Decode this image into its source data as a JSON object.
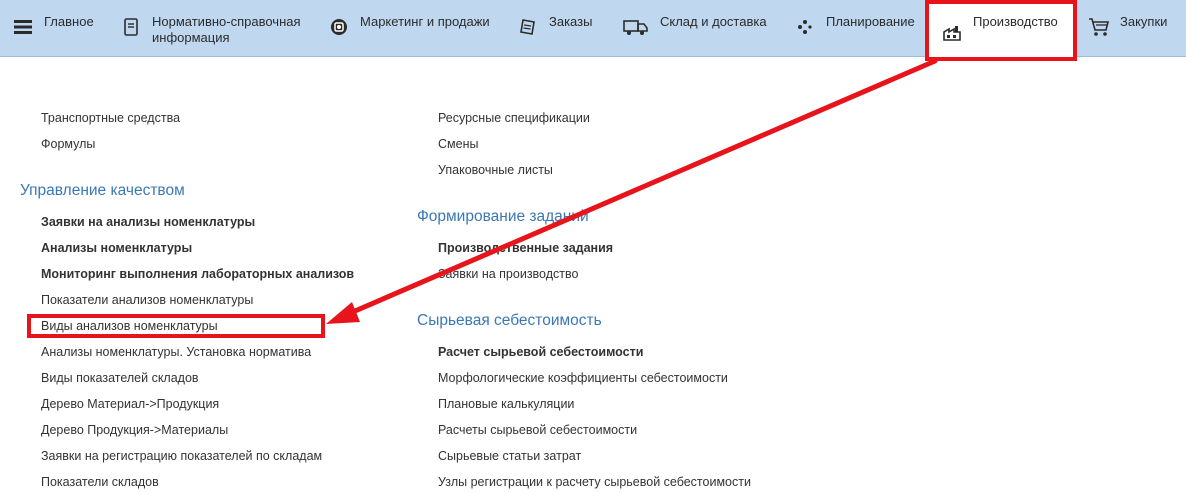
{
  "nav": {
    "items": [
      {
        "label": "Главное",
        "icon": "menu-icon"
      },
      {
        "label": "Нормативно-справочная\nинформация",
        "icon": "book-icon"
      },
      {
        "label": "Маркетинг и продажи",
        "icon": "marketing-icon"
      },
      {
        "label": "Заказы",
        "icon": "orders-icon"
      },
      {
        "label": "Склад и доставка",
        "icon": "truck-icon"
      },
      {
        "label": "Планирование",
        "icon": "planning-icon"
      },
      {
        "label": "Производство",
        "icon": "factory-icon"
      },
      {
        "label": "Закупки",
        "icon": "cart-icon"
      }
    ],
    "active": "Производство"
  },
  "left_column": {
    "top_links": [
      "Транспортные средства",
      "Формулы"
    ],
    "quality": {
      "title": "Управление качеством",
      "links": [
        {
          "label": "Заявки на анализы номенклатуры",
          "bold": true
        },
        {
          "label": "Анализы номенклатуры",
          "bold": true
        },
        {
          "label": "Мониторинг выполнения лабораторных анализов",
          "bold": true
        },
        {
          "label": "Показатели анализов номенклатуры",
          "bold": false
        },
        {
          "label": "Виды анализов номенклатуры",
          "bold": false
        },
        {
          "label": "Анализы номенклатуры. Установка норматива",
          "bold": false
        },
        {
          "label": "Виды показателей складов",
          "bold": false
        },
        {
          "label": "Дерево Материал->Продукция",
          "bold": false
        },
        {
          "label": "Дерево Продукция->Материалы",
          "bold": false
        },
        {
          "label": "Заявки на регистрацию показателей по складам",
          "bold": false
        },
        {
          "label": "Показатели складов",
          "bold": false
        }
      ]
    }
  },
  "right_column": {
    "top_links": [
      "Ресурсные спецификации",
      "Смены",
      "Упаковочные листы"
    ],
    "tasks": {
      "title": "Формирование заданий",
      "links": [
        {
          "label": "Производственные задания",
          "bold": true
        },
        {
          "label": "Заявки на производство",
          "bold": false
        }
      ]
    },
    "cost": {
      "title": "Сырьевая себестоимость",
      "links": [
        {
          "label": "Расчет сырьевой себестоимости",
          "bold": true
        },
        {
          "label": "Морфологические коэффициенты себестоимости",
          "bold": false
        },
        {
          "label": "Плановые калькуляции",
          "bold": false
        },
        {
          "label": "Расчеты сырьевой себестоимости",
          "bold": false
        },
        {
          "label": "Сырьевые статьи затрат",
          "bold": false
        },
        {
          "label": "Узлы регистрации к расчету сырьевой себестоимости",
          "bold": false
        }
      ]
    }
  },
  "annotation": {
    "color": "#e8141b"
  }
}
